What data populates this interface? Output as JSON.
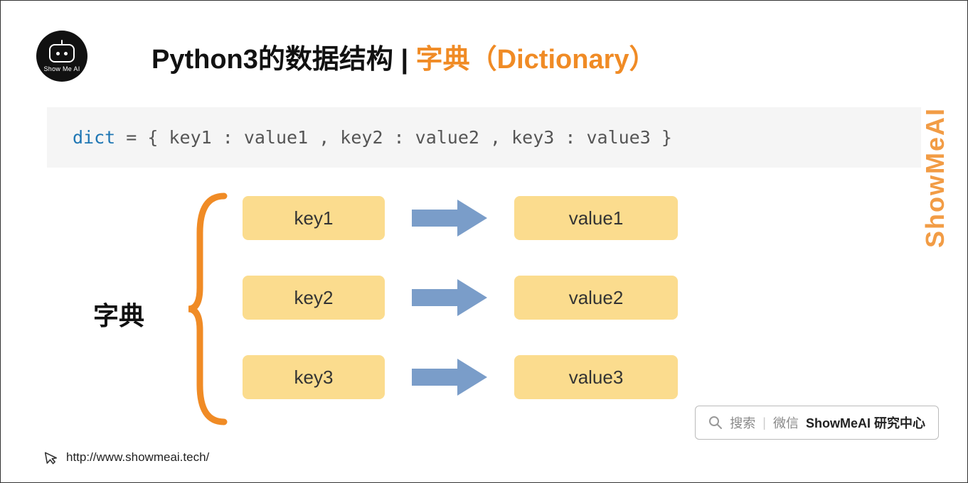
{
  "logo": {
    "text": "Show Me AI"
  },
  "title": {
    "part1": "Python3的数据结构 | ",
    "part2": "字典",
    "part3": "（Dictionary）"
  },
  "code": {
    "keyword": "dict",
    "rest": " = { key1 : value1 , key2 : value2 , key3 : value3 }"
  },
  "diagram": {
    "label": "字典",
    "rows": [
      {
        "key": "key1",
        "value": "value1"
      },
      {
        "key": "key2",
        "value": "value2"
      },
      {
        "key": "key3",
        "value": "value3"
      }
    ]
  },
  "watermark_side": "ShowMeAI",
  "footer_url": "http://www.showmeai.tech/",
  "search_badge": {
    "search": "搜索",
    "wechat": "微信",
    "name": "ShowMeAI 研究中心"
  },
  "colors": {
    "orange": "#f08b25",
    "box": "#fbdc8e",
    "arrow": "#7a9dc9"
  }
}
